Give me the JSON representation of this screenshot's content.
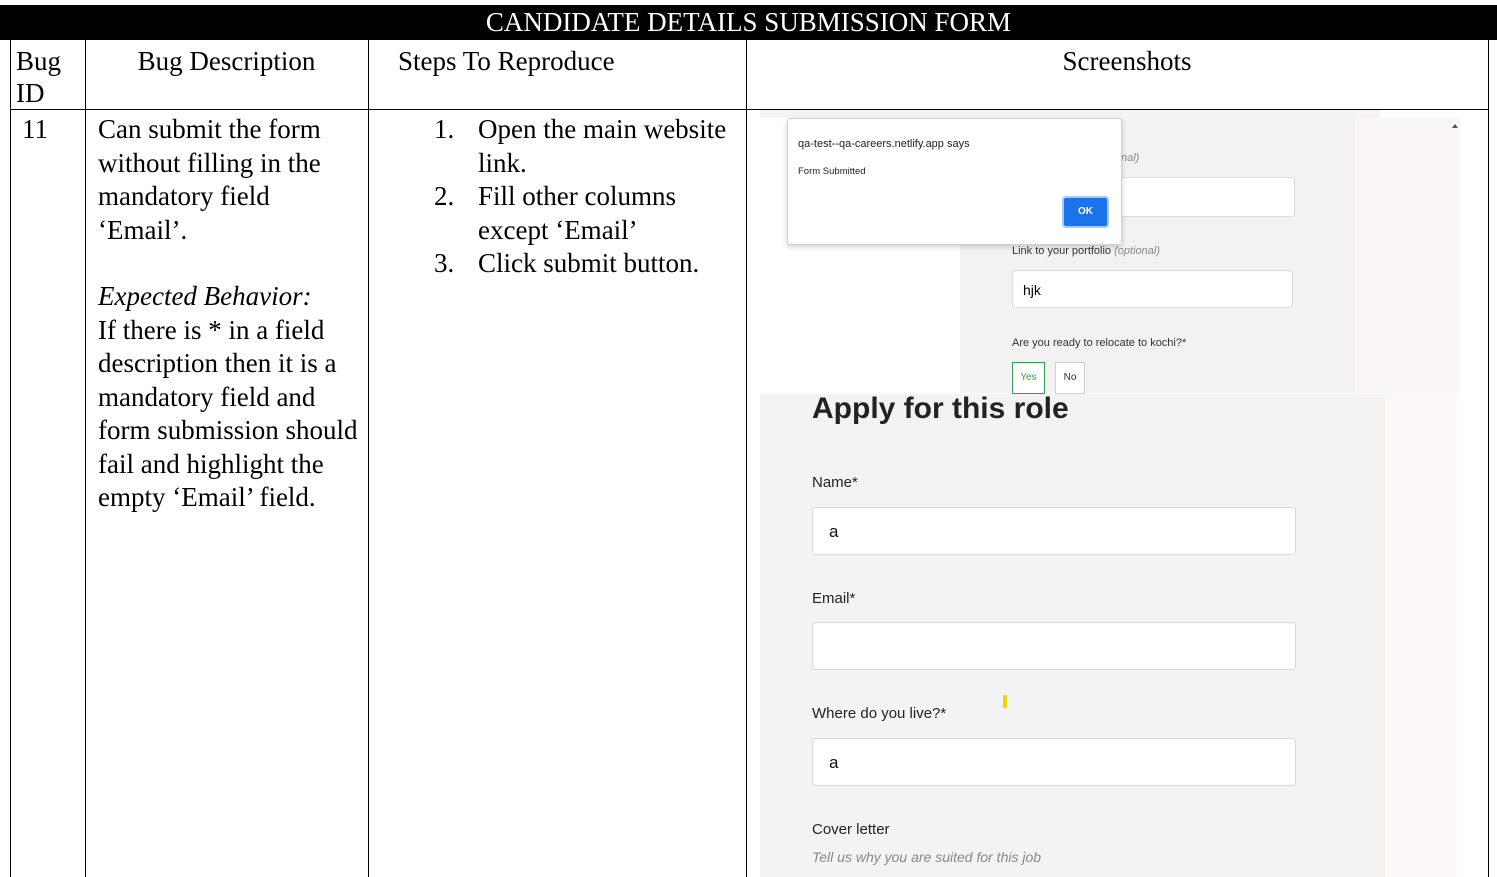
{
  "title": "CANDIDATE DETAILS SUBMISSION FORM",
  "headers": {
    "bug_id": "Bug ID",
    "bug_description": "Bug Description",
    "steps": "Steps To Reproduce",
    "screenshots": "Screenshots"
  },
  "row": {
    "bug_id": "11",
    "description": "Can submit the form without filling in the mandatory field ‘Email’.",
    "expected_label": "Expected Behavior:",
    "expected_text": "If there is * in a field description then it is a mandatory field and form submission should fail and highlight the empty ‘Email’ field.",
    "steps": [
      {
        "num": "1.",
        "text": "Open the main website link."
      },
      {
        "num": "2.",
        "text": "Fill other columns except ‘Email’"
      },
      {
        "num": "3.",
        "text": "Click submit button."
      }
    ]
  },
  "screenshot1": {
    "dialog_site": "qa-test--qa-careers.netlify.app says",
    "dialog_message": "Form Submitted",
    "ok_label": "OK",
    "partial_optional": "nal)",
    "portfolio_label": "Link to your portfolio",
    "portfolio_optional": "(optional)",
    "portfolio_value": "hjk",
    "relocate_question": "Are you ready to relocate to kochi?*",
    "yes_label": "Yes",
    "no_label": "No",
    "yes_color": "#2e9e4f"
  },
  "screenshot2": {
    "heading": "Apply for this role",
    "name_label": "Name*",
    "name_value": "a",
    "email_label": "Email*",
    "email_value": "",
    "live_label": "Where do you live?*",
    "live_value": "a",
    "cover_label": "Cover letter",
    "cover_hint": "Tell us why you are suited for this job"
  }
}
